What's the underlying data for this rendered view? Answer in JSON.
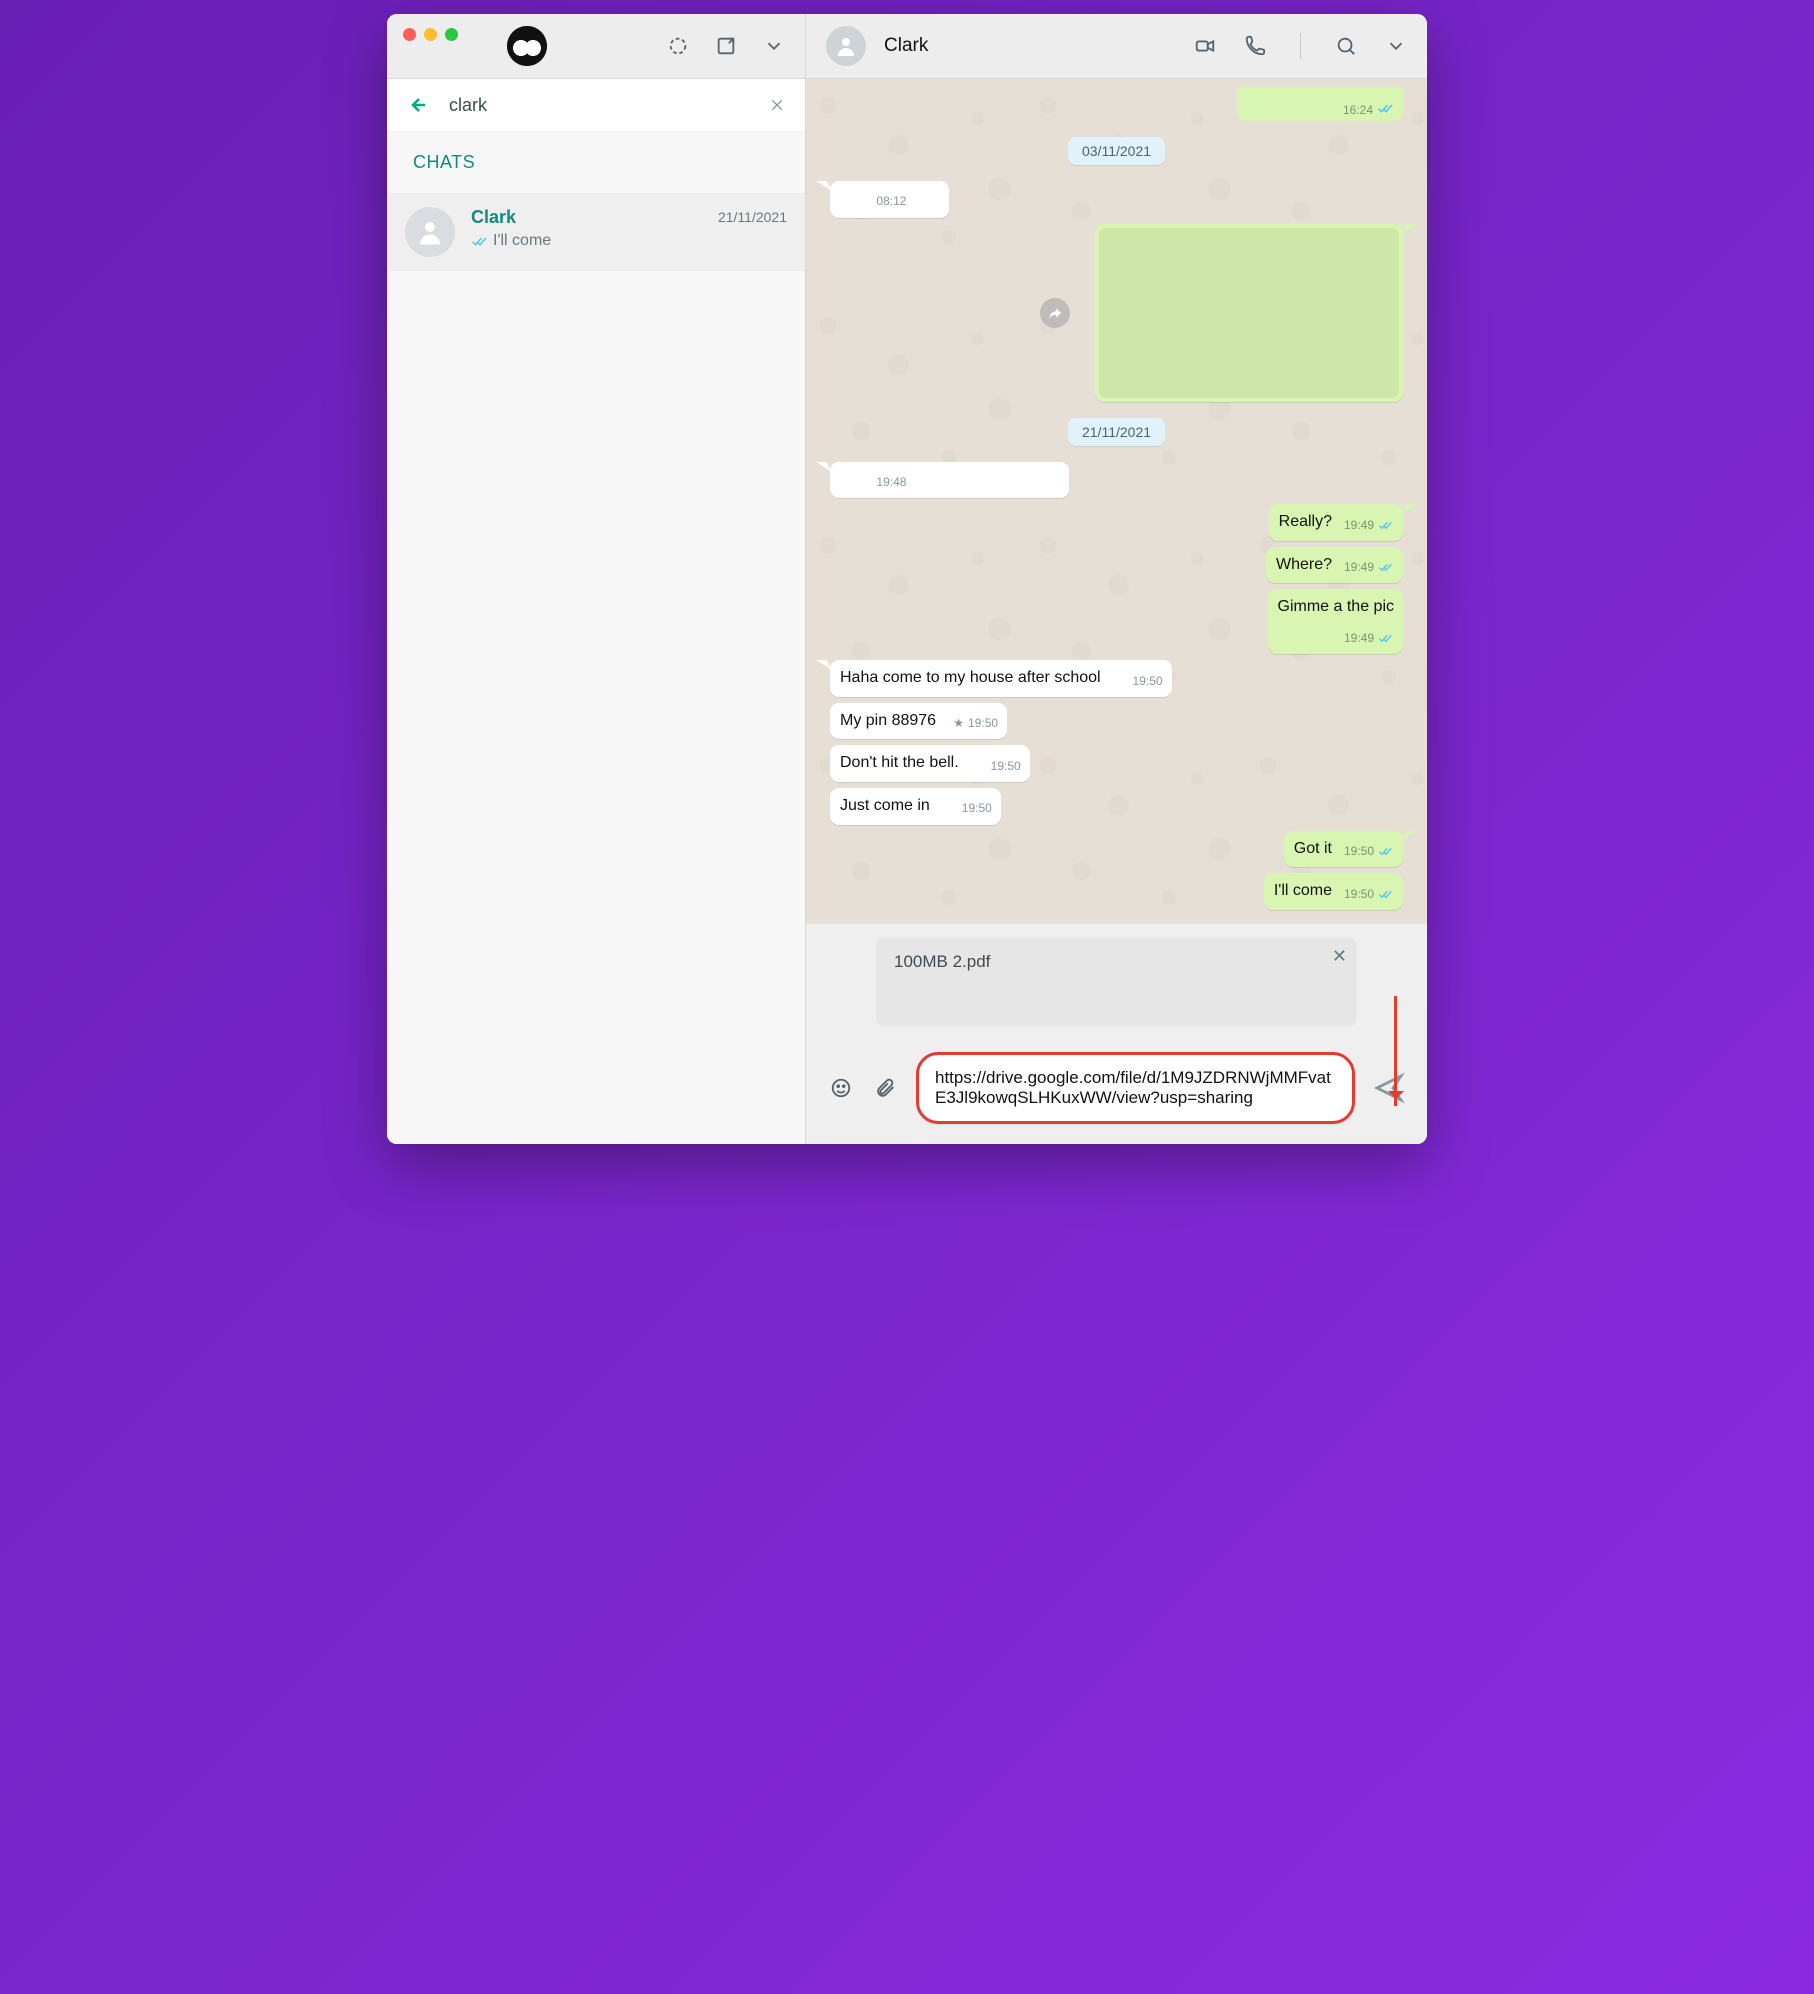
{
  "sidebar": {
    "search_value": "clark",
    "section_title": "CHATS",
    "chat": {
      "name": "Clark",
      "preview": "I'll come",
      "date": "21/11/2021"
    }
  },
  "chat_header": {
    "title": "Clark"
  },
  "top_partial_time": "16:24",
  "dates": {
    "d1": "03/11/2021",
    "d2": "21/11/2021"
  },
  "msgs": {
    "in_blank1_time": "08:12",
    "in_blank2_time": "19:48",
    "out_really": {
      "text": "Really?",
      "time": "19:49"
    },
    "out_where": {
      "text": "Where?",
      "time": "19:49"
    },
    "out_gimme": {
      "text": "Gimme a the pic",
      "time": "19:49"
    },
    "in_haha": {
      "text": "Haha come to my house after school",
      "time": "19:50"
    },
    "in_pin": {
      "text": "My pin 88976",
      "time": "19:50"
    },
    "in_bell": {
      "text": "Don't hit the bell.",
      "time": "19:50"
    },
    "in_come": {
      "text": "Just come in",
      "time": "19:50"
    },
    "out_got": {
      "text": "Got it",
      "time": "19:50"
    },
    "out_ill": {
      "text": "I'll come",
      "time": "19:50"
    }
  },
  "attachment": {
    "title": "100MB 2.pdf"
  },
  "compose": {
    "value": "https://drive.google.com/file/d/1M9JZDRNWjMMFvatE3Jl9kowqSLHKuxWW/view?usp=sharing"
  }
}
